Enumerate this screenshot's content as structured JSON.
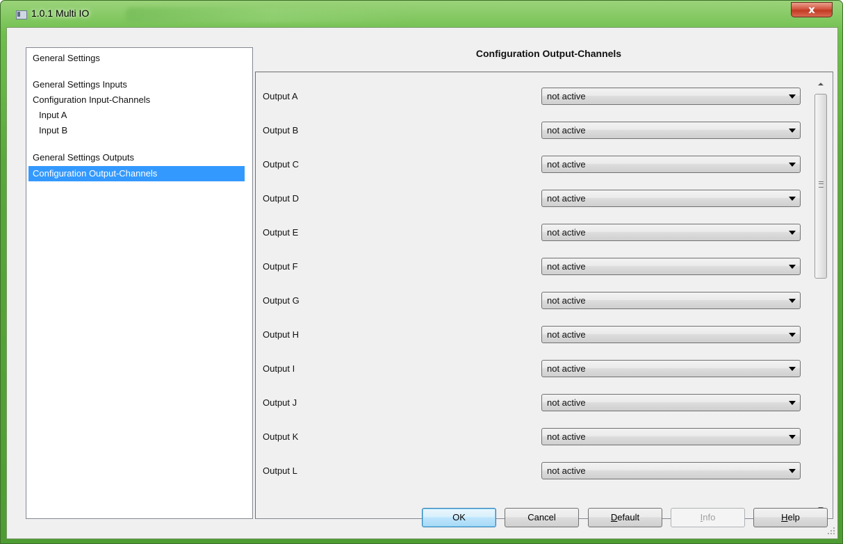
{
  "window": {
    "title": "1.0.1 Multi IO",
    "close_label": "x"
  },
  "tree": {
    "items": [
      {
        "label": "General Settings"
      },
      {
        "label": "General Settings Inputs"
      },
      {
        "label": "Configuration Input-Channels"
      },
      {
        "label": "Input  A"
      },
      {
        "label": "Input  B"
      },
      {
        "label": "General Settings Outputs"
      },
      {
        "label": "Configuration Output-Channels"
      }
    ],
    "selected": "Configuration Output-Channels"
  },
  "main": {
    "heading": "Configuration Output-Channels",
    "outputs": [
      {
        "label": "Output A",
        "value": "not active"
      },
      {
        "label": "Output B",
        "value": "not active"
      },
      {
        "label": "Output C",
        "value": "not active"
      },
      {
        "label": "Output D",
        "value": "not active"
      },
      {
        "label": "Output E",
        "value": "not active"
      },
      {
        "label": "Output F",
        "value": "not active"
      },
      {
        "label": "Output G",
        "value": "not active"
      },
      {
        "label": "Output H",
        "value": "not active"
      },
      {
        "label": "Output I",
        "value": "not active"
      },
      {
        "label": "Output J",
        "value": "not active"
      },
      {
        "label": "Output K",
        "value": "not active"
      },
      {
        "label": "Output L",
        "value": "not active"
      }
    ]
  },
  "buttons": {
    "ok": "OK",
    "cancel": "Cancel",
    "default_first": "D",
    "default_rest": "efault",
    "info_first": "I",
    "info_rest": "nfo",
    "help_first": "H",
    "help_rest": "elp"
  },
  "colors": {
    "selection": "#3399ff",
    "frame": "#5aa83b",
    "close": "#c23a22"
  }
}
